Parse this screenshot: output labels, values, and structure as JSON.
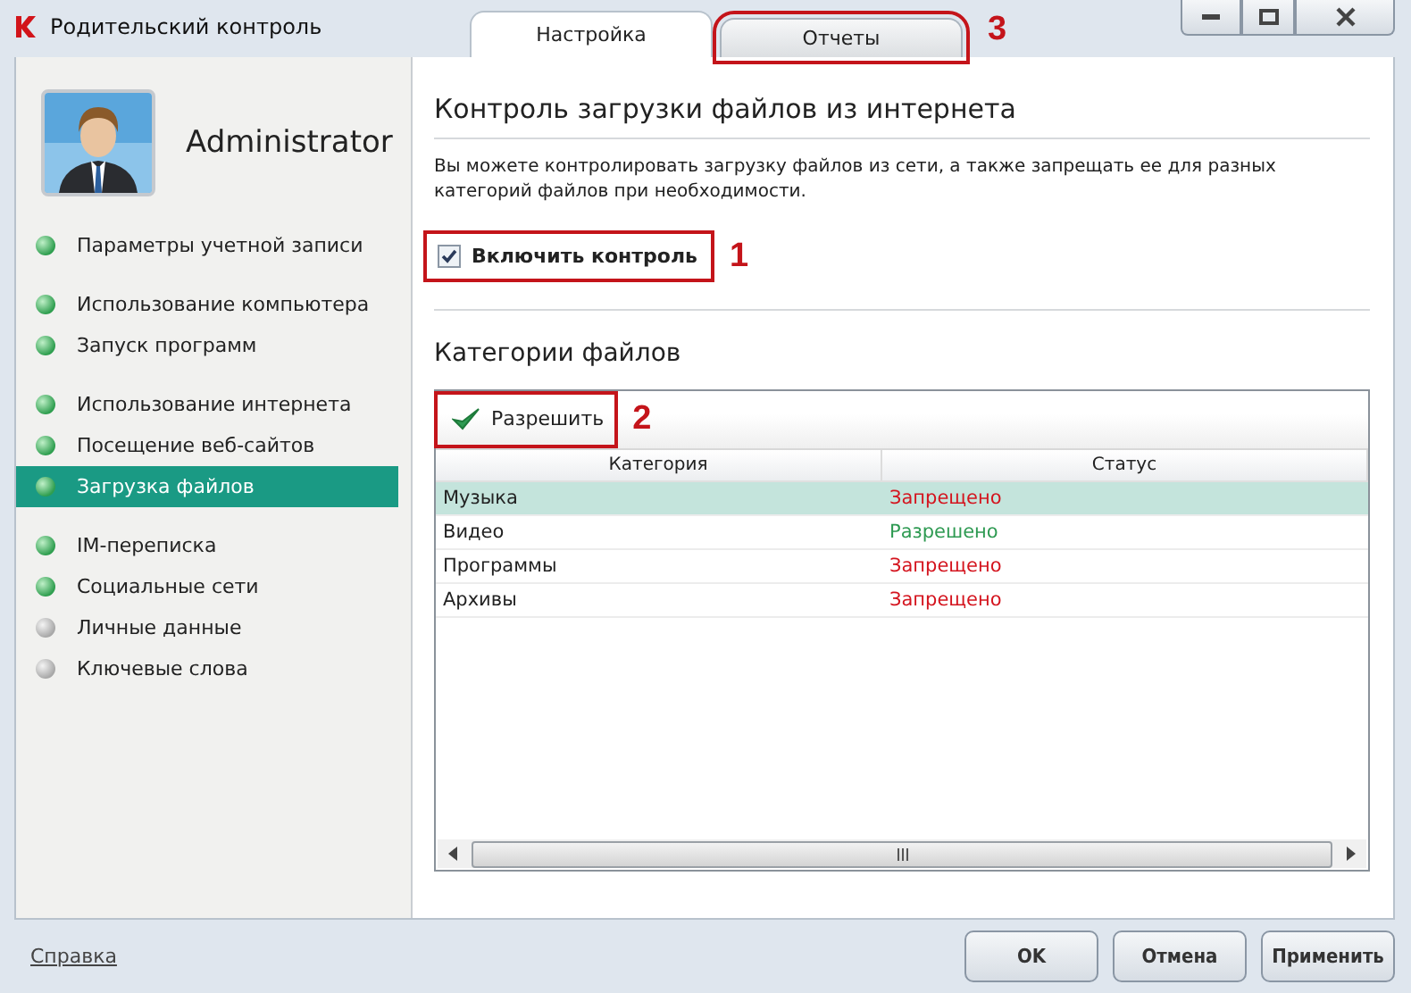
{
  "window": {
    "title": "Родительский контроль"
  },
  "tabs": [
    {
      "label": "Настройка",
      "selected": true
    },
    {
      "label": "Отчеты",
      "selected": false,
      "callout": "3"
    }
  ],
  "sidebar": {
    "user": "Administrator",
    "avatar": {
      "kind": "picture"
    },
    "groups": [
      [
        {
          "label": "Параметры учетной записи",
          "active": true,
          "selected": false
        }
      ],
      [
        {
          "label": "Использование компьютера",
          "active": true,
          "selected": false
        },
        {
          "label": "Запуск программ",
          "active": true,
          "selected": false
        }
      ],
      [
        {
          "label": "Использование интернета",
          "active": true,
          "selected": false
        },
        {
          "label": "Посещение веб-сайтов",
          "active": true,
          "selected": false
        },
        {
          "label": "Загрузка файлов",
          "active": true,
          "selected": true
        }
      ],
      [
        {
          "label": "IM-переписка",
          "active": true,
          "selected": false
        },
        {
          "label": "Социальные сети",
          "active": true,
          "selected": false
        },
        {
          "label": "Личные данные",
          "active": false,
          "selected": false
        },
        {
          "label": "Ключевые слова",
          "active": false,
          "selected": false
        }
      ]
    ]
  },
  "content": {
    "heading": "Контроль загрузки файлов из интернета",
    "description": "Вы можете контролировать загрузку файлов из сети, а также запрещать ее для разных категорий файлов при необходимости.",
    "enable": {
      "label": "Включить контроль",
      "checked": true,
      "callout": "1"
    },
    "section": "Категории файлов",
    "toolbar": [
      {
        "label": "Разрешить",
        "callout": "2"
      }
    ],
    "table": {
      "columns": [
        "Категория",
        "Статус"
      ],
      "rows": [
        {
          "category": "Музыка",
          "status": "Запрещено",
          "kind": "denied",
          "selected": true
        },
        {
          "category": "Видео",
          "status": "Разрешено",
          "kind": "allowed",
          "selected": false
        },
        {
          "category": "Программы",
          "status": "Запрещено",
          "kind": "denied",
          "selected": false
        },
        {
          "category": "Архивы",
          "status": "Запрещено",
          "kind": "denied",
          "selected": false
        }
      ]
    }
  },
  "footer": {
    "help_link": "Справка",
    "buttons": [
      "OK",
      "Отмена",
      "Применить"
    ]
  }
}
